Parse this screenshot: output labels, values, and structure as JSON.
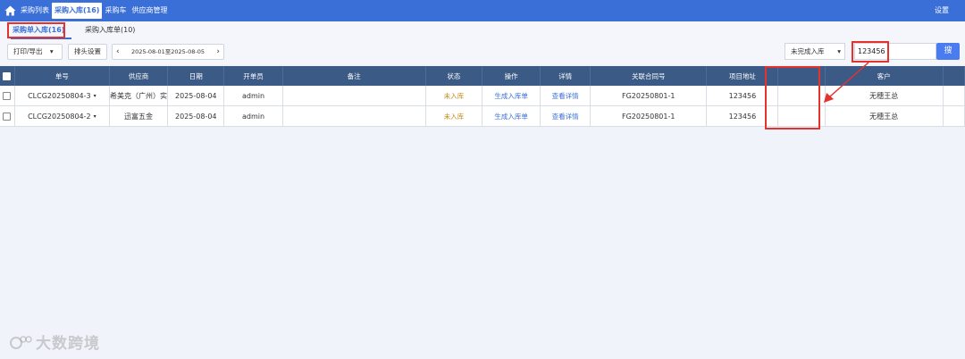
{
  "nav": {
    "items": [
      "采购列表",
      "采购入库(16)",
      "采购车",
      "供应商管理"
    ],
    "settings": "设置"
  },
  "subtabs": [
    "采购单入库(16)",
    "采购入库单(10)"
  ],
  "toolbar": {
    "print_label": "打印/导出",
    "order_label": "排头设置",
    "date_range": "2025-08-01至2025-08-05",
    "status_select": "未完成入库",
    "search_value": "123456",
    "search_button": "搜"
  },
  "table": {
    "headers": [
      "单号",
      "供应商",
      "日期",
      "开单员",
      "备注",
      "状态",
      "操作",
      "详情",
      "关联合同号",
      "项目地址",
      "客户"
    ],
    "rows": [
      {
        "order_no": "CLCG20250804-3",
        "supplier": "希美克（广州）实",
        "date": "2025-08-04",
        "creator": "admin",
        "note": "",
        "status": "未入库",
        "action": "生成入库单",
        "detail": "查看详情",
        "contract": "FG20250801-1",
        "address": "123456",
        "customer": "无穗王总"
      },
      {
        "order_no": "CLCG20250804-2",
        "supplier": "迅富五金",
        "date": "2025-08-04",
        "creator": "admin",
        "note": "",
        "status": "未入库",
        "action": "生成入库单",
        "detail": "查看详情",
        "contract": "FG20250801-1",
        "address": "123456",
        "customer": "无穗王总"
      }
    ]
  },
  "watermark": "大数跨境",
  "colors": {
    "nav": "#3a6fd8",
    "header": "#3b5a86",
    "highlight": "#e5322d",
    "status": "#c48a18"
  }
}
